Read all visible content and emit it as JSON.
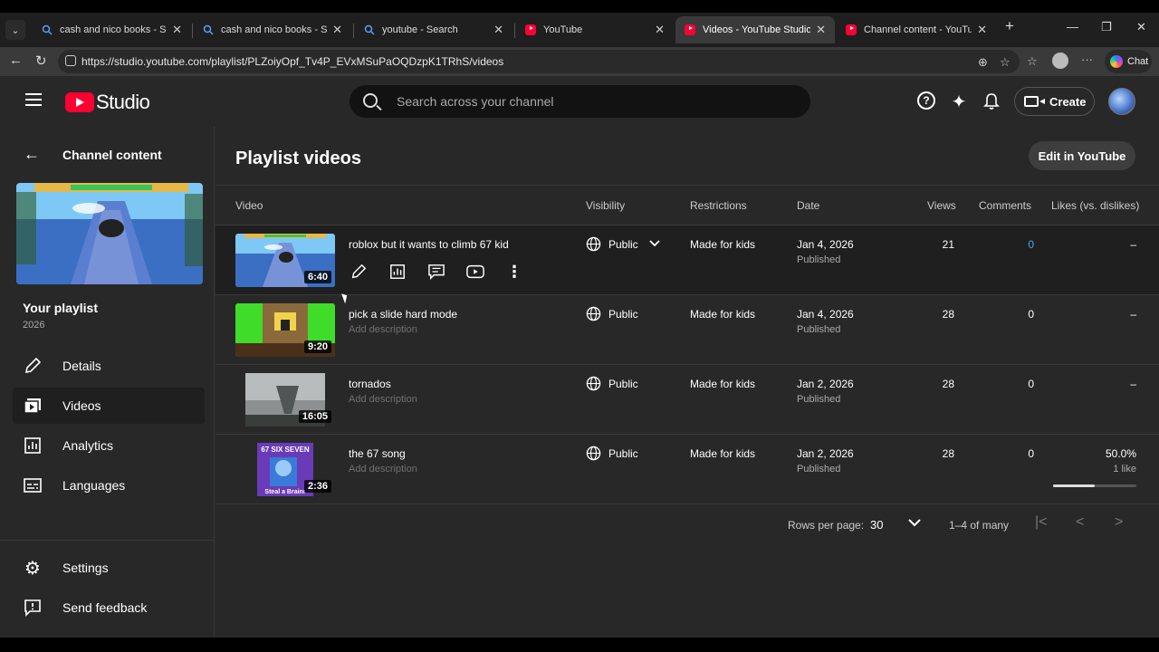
{
  "browser": {
    "tabs": [
      {
        "label": "cash and nico books - Search",
        "icon": "search-icon"
      },
      {
        "label": "cash and nico books - Search",
        "icon": "search-icon"
      },
      {
        "label": "youtube - Search",
        "icon": "search-icon"
      },
      {
        "label": "YouTube",
        "icon": "youtube-icon"
      },
      {
        "label": "Videos - YouTube Studio",
        "icon": "youtube-icon",
        "active": true
      },
      {
        "label": "Channel content - YouTube Studio",
        "icon": "youtube-icon"
      }
    ],
    "url": "https://studio.youtube.com/playlist/PLZoiyOpf_Tv4P_EVxMSuPaOQDzpK1TRhS/videos",
    "chat_label": "Chat"
  },
  "header": {
    "logo_text": "Studio",
    "search_placeholder": "Search across your channel",
    "create_label": "Create"
  },
  "sidebar": {
    "back_label": "Channel content",
    "playlist_title": "Your playlist",
    "playlist_year": "2026",
    "items": [
      {
        "label": "Details",
        "icon": "pencil-icon"
      },
      {
        "label": "Videos",
        "icon": "video-library-icon",
        "active": true
      },
      {
        "label": "Analytics",
        "icon": "analytics-icon"
      },
      {
        "label": "Languages",
        "icon": "subtitles-icon"
      }
    ],
    "footer_items": [
      {
        "label": "Settings",
        "icon": "gear-icon"
      },
      {
        "label": "Send feedback",
        "icon": "feedback-icon"
      }
    ]
  },
  "main": {
    "title": "Playlist videos",
    "edit_button": "Edit in YouTube",
    "columns": [
      "Video",
      "Visibility",
      "Restrictions",
      "Date",
      "Views",
      "Comments",
      "Likes (vs. dislikes)"
    ],
    "rows": [
      {
        "title": "roblox but it wants to climb 67 kid",
        "description": "",
        "duration": "6:40",
        "visibility": "Public",
        "restrictions": "Made for kids",
        "date": "Jan 4, 2026",
        "date_status": "Published",
        "views": "21",
        "comments": "0",
        "likes": "–",
        "likes_sub": "",
        "hovered": true
      },
      {
        "title": "pick a slide hard mode",
        "description": "Add description",
        "duration": "9:20",
        "visibility": "Public",
        "restrictions": "Made for kids",
        "date": "Jan 4, 2026",
        "date_status": "Published",
        "views": "28",
        "comments": "0",
        "likes": "–",
        "likes_sub": ""
      },
      {
        "title": "tornados",
        "description": "Add description",
        "duration": "16:05",
        "visibility": "Public",
        "restrictions": "Made for kids",
        "date": "Jan 2, 2026",
        "date_status": "Published",
        "views": "28",
        "comments": "0",
        "likes": "–",
        "likes_sub": ""
      },
      {
        "title": "the 67 song",
        "description": "Add description",
        "duration": "2:36",
        "visibility": "Public",
        "restrictions": "Made for kids",
        "date": "Jan 2, 2026",
        "date_status": "Published",
        "views": "28",
        "comments": "0",
        "likes": "50.0%",
        "likes_sub": "1 like",
        "like_ratio": 0.5,
        "thumb_text_top": "67 SIX SEVEN",
        "thumb_text_bottom": "Steal a Brainr"
      }
    ],
    "pagination": {
      "rows_per_page_label": "Rows per page:",
      "rows_per_page": "30",
      "range": "1–4 of many"
    }
  }
}
